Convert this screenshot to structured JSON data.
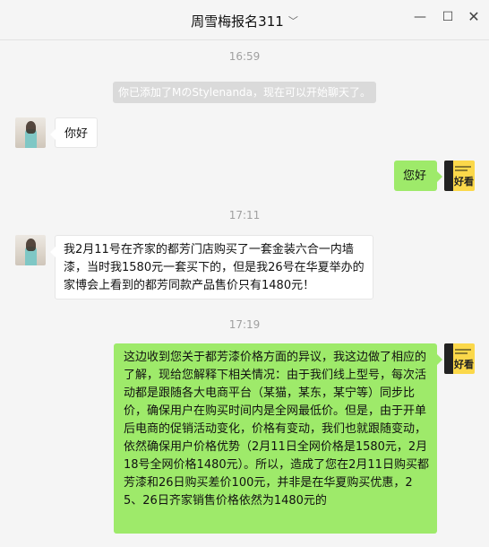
{
  "window": {
    "title": "周雪梅报名311",
    "min": "—",
    "max": "☐",
    "close": "✕"
  },
  "icons": {
    "title_dropdown": "chevron-down-icon"
  },
  "messages": {
    "ts1": "16:59",
    "system": "你已添加了MのStylenanda，现在可以开始聊天了。",
    "m1": "你好",
    "m2": "您好",
    "ts2": "17:11",
    "m3": "我2月11号在齐家的都芳门店购买了一套金装六合一内墙漆，当时我1580元一套买下的，但是我26号在华夏举办的家博会上看到的都芳同款产品售价只有1480元！",
    "ts3": "17:19",
    "m4": "这边收到您关于都芳漆价格方面的异议，我这边做了相应的了解，现给您解释下相关情况：由于我们线上型号，每次活动都是跟随各大电商平台（某猫，某东，某宁等）同步比价，确保用户在购买时间内是全网最低价。但是，由于开单后电商的促销活动变化，价格有变动，我们也就跟随变动，依然确保用户价格优势（2月11日全网价格是1580元，2月18号全网价格1480元）。所以，造成了您在2月11日购买都芳漆和26日购买差价100元，并非是在华夏购买优惠，25、26日齐家销售价格依然为1480元的"
  },
  "brand_avatar": {
    "text": "好看"
  }
}
